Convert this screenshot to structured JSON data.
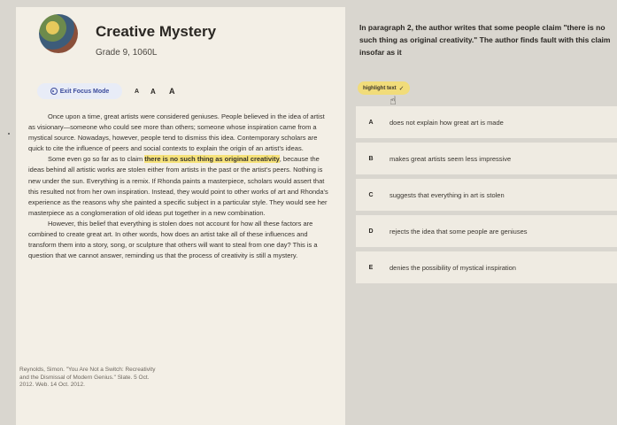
{
  "header": {
    "title": "Creative Mystery",
    "grade": "Grade 9, 1060L"
  },
  "toolbar": {
    "focus_label": "Exit Focus Mode",
    "font_small": "A",
    "font_medium": "A",
    "font_large": "A"
  },
  "passage": {
    "p1": "Once upon a time, great artists were considered geniuses. People believed in the idea of artist as visionary—someone who could see more than others; someone whose inspiration came from a mystical source. Nowadays, however, people tend to dismiss this idea. Contemporary scholars are quick to cite the influence of peers and social contexts to explain the origin of an artist's ideas.",
    "p2_before": "Some even go so far as to claim ",
    "p2_highlight": "there is no such thing as original creativity",
    "p2_after": ", because the ideas behind all artistic works are stolen either from artists in the past or the artist's peers. Nothing is new under the sun. Everything is a remix. If Rhonda paints a masterpiece, scholars would assert that this resulted not from her own inspiration. Instead, they would point to other works of art and Rhonda's experience as the reasons why she painted a specific subject in a particular style. They would see her masterpiece as a conglomeration of old ideas put together in a new combination.",
    "p3": "However, this belief that everything is stolen does not account for how all these factors are combined to create great art. In other words, how does an artist take all of these influences and transform them into a story, song, or sculpture that others will want to steal from one day? This is a question that we cannot answer, reminding us that the process of creativity is still a mystery."
  },
  "citation": "Reynolds, Simon. \"You Are Not a Switch: Recreativity and the Dismissal of Modern Genius.\" Slate. 5 Oct. 2012. Web. 14 Oct. 2012.",
  "question": {
    "prompt": "In paragraph 2, the author writes that some people claim \"there is no such thing as original creativity.\" The author finds fault with this claim insofar as it",
    "highlight_label": "highlight text",
    "choices": [
      {
        "letter": "A",
        "text": "does not explain how great art is made"
      },
      {
        "letter": "B",
        "text": "makes great artists seem less impressive"
      },
      {
        "letter": "C",
        "text": "suggests that everything in art is stolen"
      },
      {
        "letter": "D",
        "text": "rejects the idea that some people are geniuses"
      },
      {
        "letter": "E",
        "text": "denies the possibility of mystical inspiration"
      }
    ]
  }
}
